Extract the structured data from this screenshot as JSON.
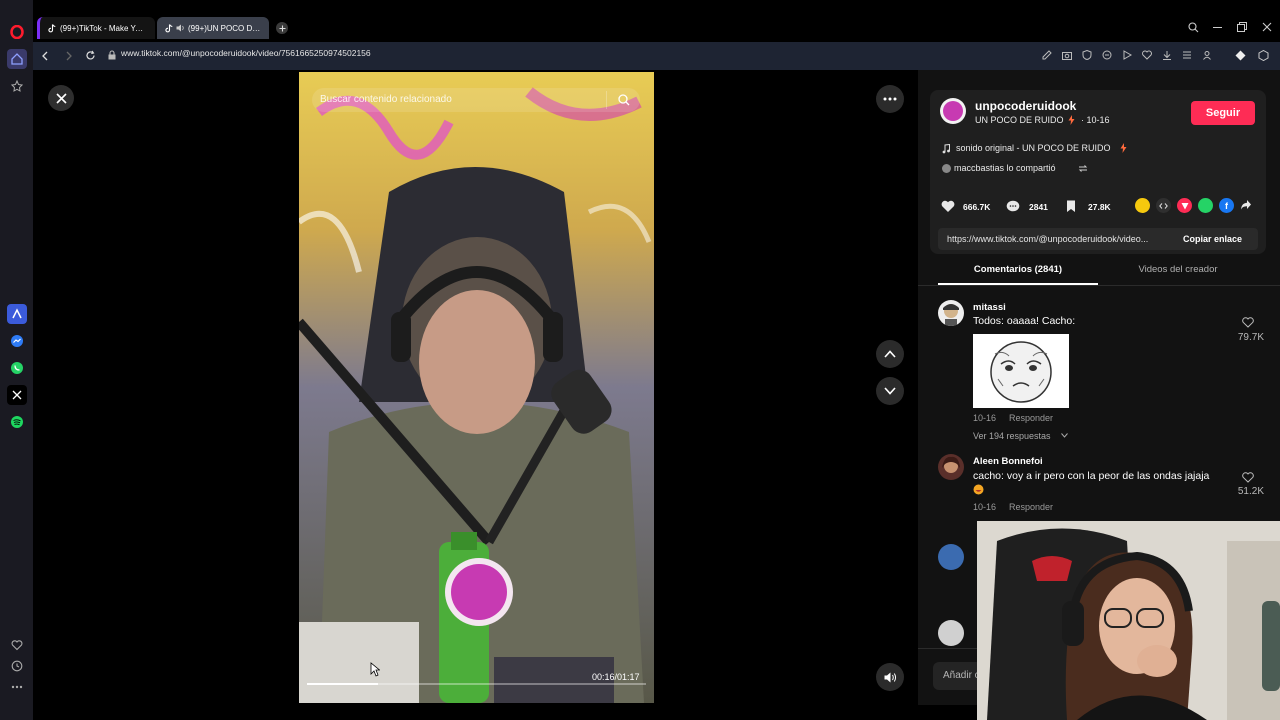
{
  "browser": {
    "tabs": [
      {
        "label": "(99+)TikTok - Make Your Day",
        "active": false
      },
      {
        "label": "(99+)UN POCO DE RUIDO",
        "active": true
      }
    ],
    "url": "www.tiktok.com/@unpocoderuidook/video/7561665250974502156"
  },
  "video": {
    "search_placeholder": "Buscar contenido relacionado",
    "time": "00:16/01:17",
    "progress": 0.21
  },
  "creator": {
    "handle": "unpocoderuidook",
    "display_name": "UN POCO DE RUIDO",
    "date": "· 10-16",
    "follow_label": "Seguir",
    "sound": "sonido original - UN POCO DE RUIDO",
    "shared_by": "maccbastias lo compartió"
  },
  "stats": {
    "likes": "666.7K",
    "comments": "2841",
    "saves": "27.8K"
  },
  "link": {
    "url": "https://www.tiktok.com/@unpocoderuidook/video...",
    "copy_label": "Copiar enlace"
  },
  "tabs": {
    "comments": "Comentarios (2841)",
    "creator_videos": "Videos del creador"
  },
  "comments": [
    {
      "user": "mitassi",
      "text": "Todos: oaaaa! Cacho:",
      "date": "10-16",
      "reply": "Responder",
      "likes": "79.7K",
      "replies": "Ver 194 respuestas"
    },
    {
      "user": "Aleen Bonnefoi",
      "text": "cacho: voy a ir pero con la peor de las ondas jajaja",
      "date": "10-16",
      "reply": "Responder",
      "likes": "51.2K"
    }
  ],
  "add_comment_placeholder": "Añadir c",
  "colors": {
    "follow": "#fe2c55",
    "accent_underline": "#ffffff",
    "sidebar_opera": "#ff1b2d"
  }
}
